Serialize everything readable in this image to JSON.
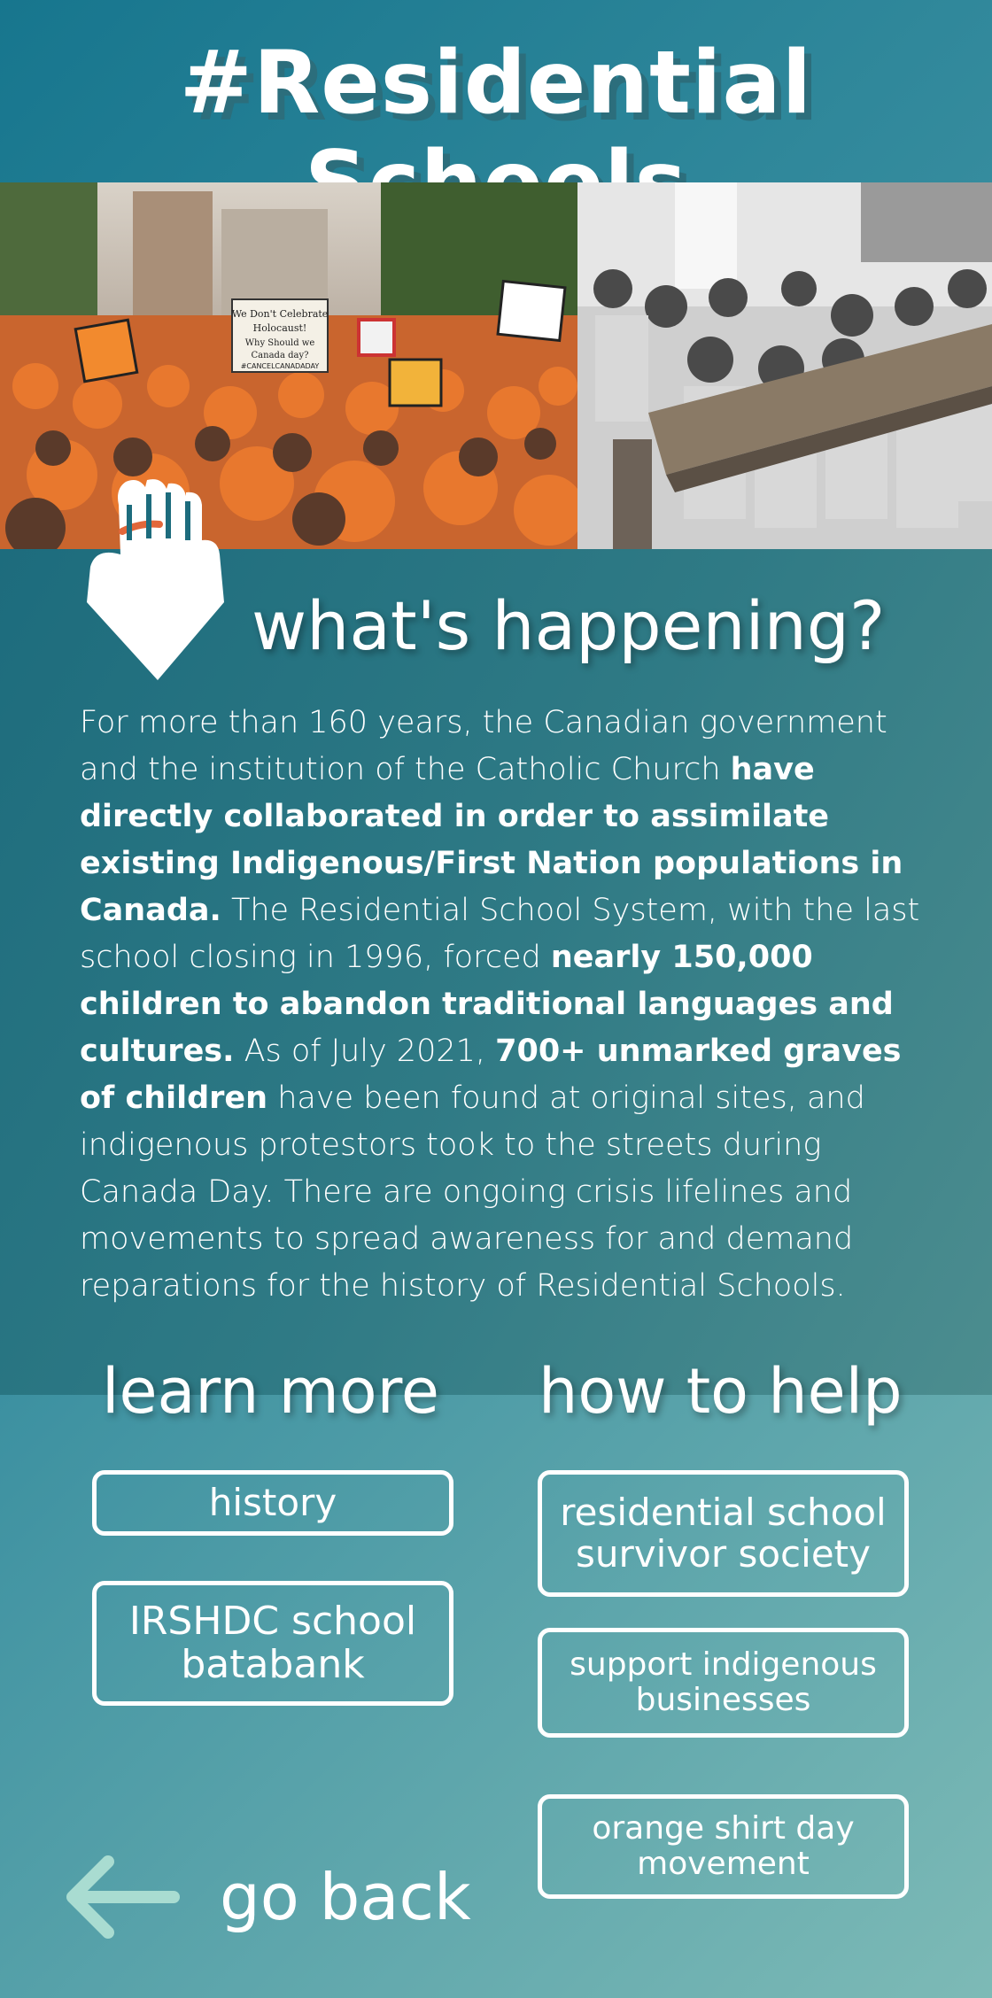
{
  "header": {
    "title": "#Residential Schools"
  },
  "photos": {
    "left": {
      "icon": "protest-crowd-photo",
      "sign_text": [
        "We Don't Celebrate",
        "Holocaust!",
        "Why Should we",
        "Canada day?",
        "#CANCELCANADADAY"
      ]
    },
    "right": {
      "icon": "historical-classroom-photo"
    }
  },
  "logo": {
    "icon": "raised-fist-pin-icon",
    "colors": {
      "fist": "#ffffff",
      "accent": "#e2673a"
    }
  },
  "info": {
    "heading": "what's happening?",
    "p1": "For more than 160 years, the Canadian government and the institution of the Catholic Church ",
    "b1": "have directly collaborated in order to assimilate existing  Indigenous/First Nation populations in Canada.",
    "p2": " The Residential School System, with the last school closing in 1996, forced ",
    "b2": "nearly 150,000 children to abandon traditional languages and cultures.",
    "p3": " As of July 2021, ",
    "b3": "700+ unmarked graves of children",
    "p4": " have been found at original sites, and indigenous protestors took to the streets during Canada Day. There are ongoing crisis lifelines and movements to spread awareness for and demand reparations for the history of Residential Schools."
  },
  "learn_more": {
    "heading": "learn more",
    "links": [
      "history",
      "IRSHDC school batabank"
    ]
  },
  "how_to_help": {
    "heading": "how to help",
    "links": [
      "residential school survivor society",
      "support indigenous businesses",
      "orange shirt day movement"
    ]
  },
  "nav": {
    "back_label": "go back",
    "back_icon": "left-arrow-icon",
    "arrow_color": "#a9dcd1"
  }
}
